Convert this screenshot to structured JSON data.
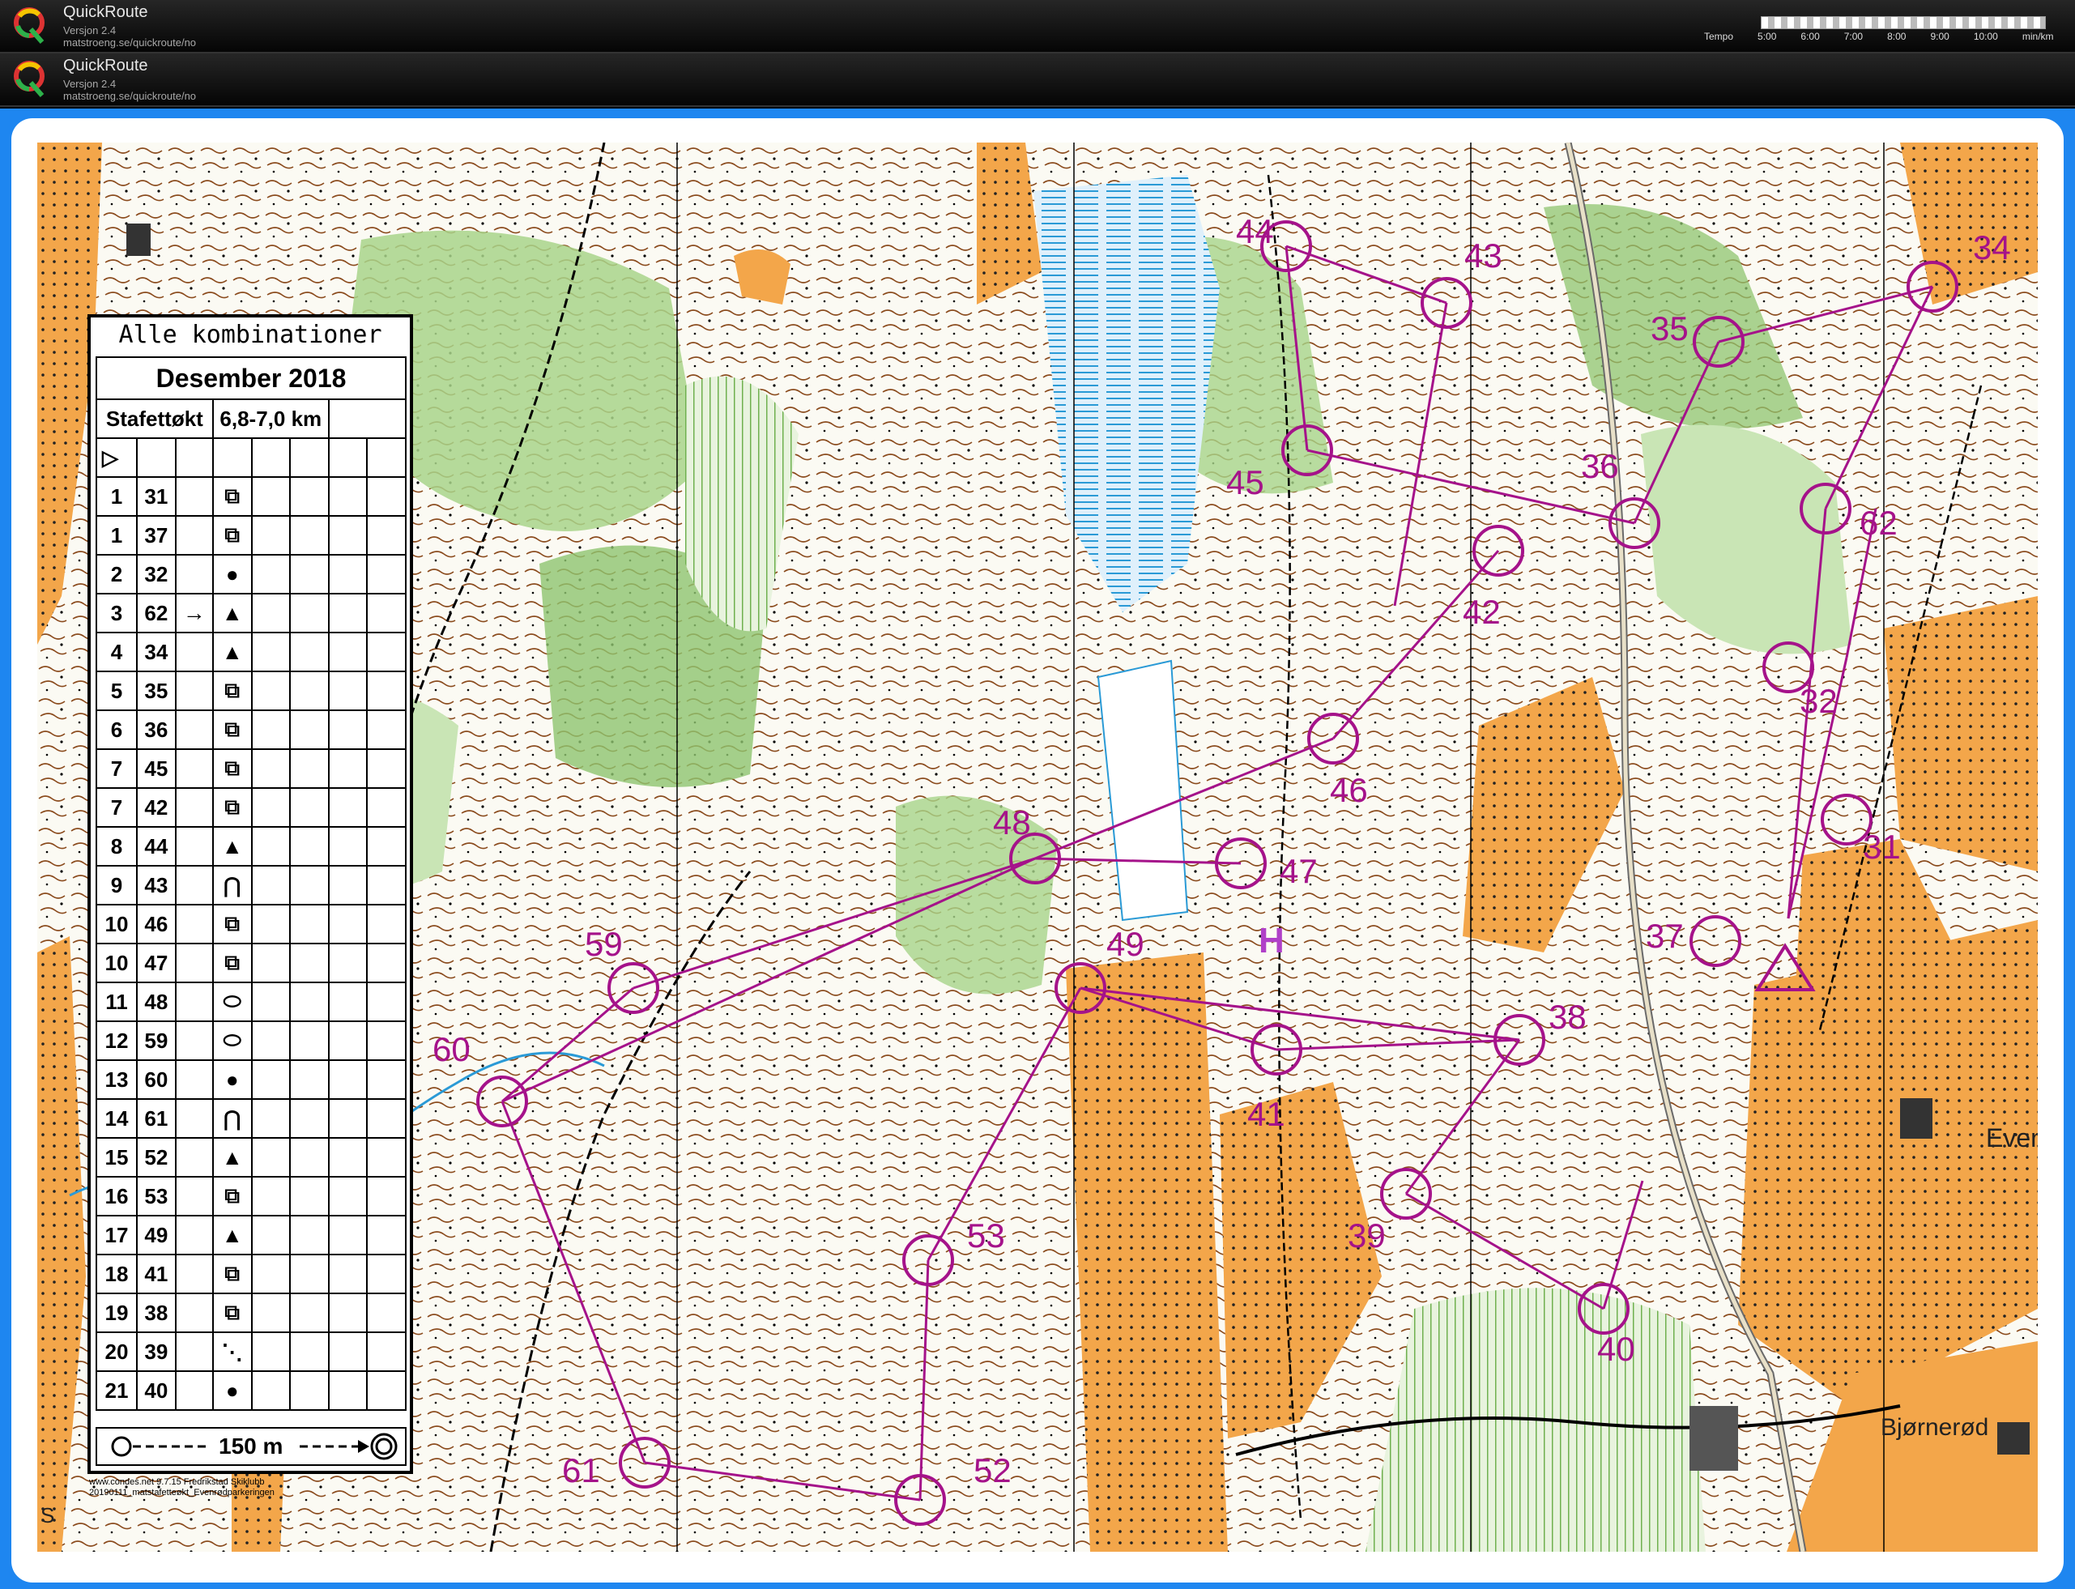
{
  "app": {
    "name": "QuickRoute",
    "version": "Versjon 2.4",
    "url": "matstroeng.se/quickroute/no"
  },
  "tempo": {
    "label": "Tempo",
    "ticks": [
      "5:00",
      "6:00",
      "7:00",
      "8:00",
      "9:00",
      "10:00"
    ],
    "unit": "min/km"
  },
  "legend": {
    "title": "Alle kombinationer",
    "event": "Desember 2018",
    "course": "Stafettøkt",
    "length": "6,8-7,0 km",
    "rows": [
      {
        "n": "1",
        "code": "31",
        "dir": "",
        "sym": "⧉"
      },
      {
        "n": "1",
        "code": "37",
        "dir": "",
        "sym": "⧉"
      },
      {
        "n": "2",
        "code": "32",
        "dir": "",
        "sym": "●"
      },
      {
        "n": "3",
        "code": "62",
        "dir": "→",
        "sym": "▲"
      },
      {
        "n": "4",
        "code": "34",
        "dir": "",
        "sym": "▲"
      },
      {
        "n": "5",
        "code": "35",
        "dir": "",
        "sym": "⧉"
      },
      {
        "n": "6",
        "code": "36",
        "dir": "",
        "sym": "⧉"
      },
      {
        "n": "7",
        "code": "45",
        "dir": "",
        "sym": "⧉"
      },
      {
        "n": "7",
        "code": "42",
        "dir": "",
        "sym": "⧉"
      },
      {
        "n": "8",
        "code": "44",
        "dir": "",
        "sym": "▲"
      },
      {
        "n": "9",
        "code": "43",
        "dir": "",
        "sym": "⋂"
      },
      {
        "n": "10",
        "code": "46",
        "dir": "",
        "sym": "⧉"
      },
      {
        "n": "10",
        "code": "47",
        "dir": "",
        "sym": "⧉"
      },
      {
        "n": "11",
        "code": "48",
        "dir": "",
        "sym": "⬭"
      },
      {
        "n": "12",
        "code": "59",
        "dir": "",
        "sym": "⬭"
      },
      {
        "n": "13",
        "code": "60",
        "dir": "",
        "sym": "●"
      },
      {
        "n": "14",
        "code": "61",
        "dir": "",
        "sym": "⋂"
      },
      {
        "n": "15",
        "code": "52",
        "dir": "",
        "sym": "▲"
      },
      {
        "n": "16",
        "code": "53",
        "dir": "",
        "sym": "⧉"
      },
      {
        "n": "17",
        "code": "49",
        "dir": "",
        "sym": "▲"
      },
      {
        "n": "18",
        "code": "41",
        "dir": "",
        "sym": "⧉"
      },
      {
        "n": "19",
        "code": "38",
        "dir": "",
        "sym": "⧉"
      },
      {
        "n": "20",
        "code": "39",
        "dir": "",
        "sym": "⋱"
      },
      {
        "n": "21",
        "code": "40",
        "dir": "",
        "sym": "●"
      }
    ],
    "footer": "150 m",
    "credit_line1": "www.condes.net 9.7.15 Fredrikstad Skiklubb",
    "credit_line2": "20190111_matstafetteøkt_Evenrødparkeringen"
  },
  "map": {
    "colors": {
      "open": "#f3a64a",
      "forest_green": "#8fc46f",
      "light_green": "#c9e5b5",
      "water": "#2a9ad6",
      "course": "#a5128a",
      "contour": "#8a4a1c"
    },
    "place_labels": [
      "Even",
      "Bjørnerød",
      "S"
    ],
    "parking": "H",
    "controls": [
      {
        "code": "44"
      },
      {
        "code": "43"
      },
      {
        "code": "35"
      },
      {
        "code": "34"
      },
      {
        "code": "45"
      },
      {
        "code": "36"
      },
      {
        "code": "62"
      },
      {
        "code": "42"
      },
      {
        "code": "32"
      },
      {
        "code": "46"
      },
      {
        "code": "48"
      },
      {
        "code": "47"
      },
      {
        "code": "31"
      },
      {
        "code": "59"
      },
      {
        "code": "49"
      },
      {
        "code": "37"
      },
      {
        "code": "38"
      },
      {
        "code": "60"
      },
      {
        "code": "41"
      },
      {
        "code": "53"
      },
      {
        "code": "39"
      },
      {
        "code": "40"
      },
      {
        "code": "61"
      },
      {
        "code": "52"
      }
    ]
  }
}
